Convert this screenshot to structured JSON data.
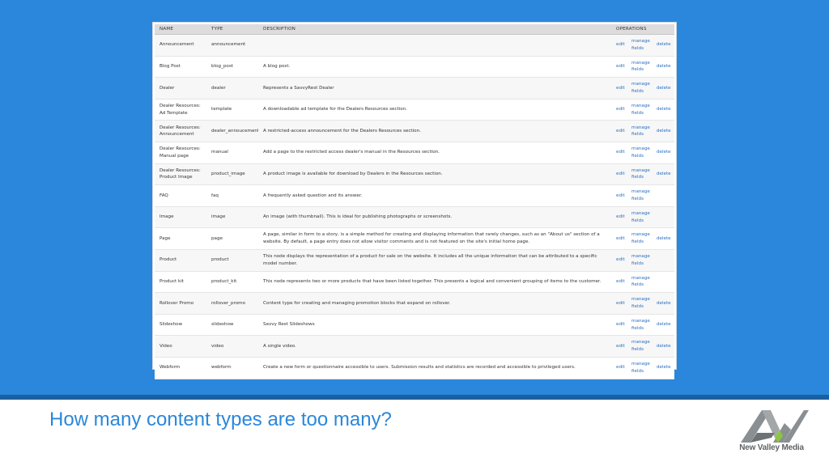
{
  "table": {
    "headers": {
      "name": "NAME",
      "type": "TYPE",
      "description": "DESCRIPTION",
      "operations": "OPERATIONS"
    },
    "rows": [
      {
        "name": "Announcement",
        "type": "announcement",
        "description": "",
        "edit": "edit",
        "manage": "manage fields",
        "delete": "delete"
      },
      {
        "name": "Blog Post",
        "type": "blog_post",
        "description": "A blog post.",
        "edit": "edit",
        "manage": "manage fields",
        "delete": "delete"
      },
      {
        "name": "Dealer",
        "type": "dealer",
        "description": "Represents a SavvyRest Dealer",
        "edit": "edit",
        "manage": "manage fields",
        "delete": "delete"
      },
      {
        "name": "Dealer Resources: Ad Template",
        "type": "template",
        "description": "A downloadable ad template for the Dealers Resources section.",
        "edit": "edit",
        "manage": "manage fields",
        "delete": "delete"
      },
      {
        "name": "Dealer Resources: Announcement",
        "type": "dealer_annoucement",
        "description": "A restricted-access announcement for the Dealers Resources section.",
        "edit": "edit",
        "manage": "manage fields",
        "delete": "delete"
      },
      {
        "name": "Dealer Resources: Manual page",
        "type": "manual",
        "description": "Add a page to the restricted access dealer's manual in the Resources section.",
        "edit": "edit",
        "manage": "manage fields",
        "delete": "delete"
      },
      {
        "name": "Dealer Resources: Product Image",
        "type": "product_image",
        "description": "A product image is available for download by Dealers in the Resources section.",
        "edit": "edit",
        "manage": "manage fields",
        "delete": "delete"
      },
      {
        "name": "FAQ",
        "type": "faq",
        "description": "A frequently asked question and its answer.",
        "edit": "edit",
        "manage": "manage fields",
        "delete": ""
      },
      {
        "name": "Image",
        "type": "image",
        "description": "An image (with thumbnail). This is ideal for publishing photographs or screenshots.",
        "edit": "edit",
        "manage": "manage fields",
        "delete": ""
      },
      {
        "name": "Page",
        "type": "page",
        "description": "A page, similar in form to a story, is a simple method for creating and displaying information that rarely changes, such as an \"About us\" section of a website. By default, a page entry does not allow visitor comments and is not featured on the site's initial home page.",
        "edit": "edit",
        "manage": "manage fields",
        "delete": "delete"
      },
      {
        "name": "Product",
        "type": "product",
        "description": "This node displays the representation of a product for sale on the website. It includes all the unique information that can be attributed to a specific model number.",
        "edit": "edit",
        "manage": "manage fields",
        "delete": ""
      },
      {
        "name": "Product kit",
        "type": "product_kit",
        "description": "This node represents two or more products that have been listed together. This presents a logical and convenient grouping of items to the customer.",
        "edit": "edit",
        "manage": "manage fields",
        "delete": ""
      },
      {
        "name": "Rollover Promo",
        "type": "rollover_promo",
        "description": "Content type for creating and managing promotion blocks that expand on rollover.",
        "edit": "edit",
        "manage": "manage fields",
        "delete": "delete"
      },
      {
        "name": "Slideshow",
        "type": "slideshow",
        "description": "Savvy Rest Slideshows",
        "edit": "edit",
        "manage": "manage fields",
        "delete": "delete"
      },
      {
        "name": "Video",
        "type": "video",
        "description": "A single video.",
        "edit": "edit",
        "manage": "manage fields",
        "delete": "delete"
      },
      {
        "name": "Webform",
        "type": "webform",
        "description": "Create a new form or questionnaire accessible to users. Submission results and statistics are recorded and accessible to privileged users.",
        "edit": "edit",
        "manage": "manage fields",
        "delete": "delete"
      }
    ]
  },
  "caption": "How many content types are too many?",
  "logo": {
    "text": "New Valley Media"
  },
  "colors": {
    "accent": "#2a87db",
    "link": "#2a6fbf",
    "logo_gray": "#8a8f93",
    "logo_green": "#8cc63f"
  }
}
